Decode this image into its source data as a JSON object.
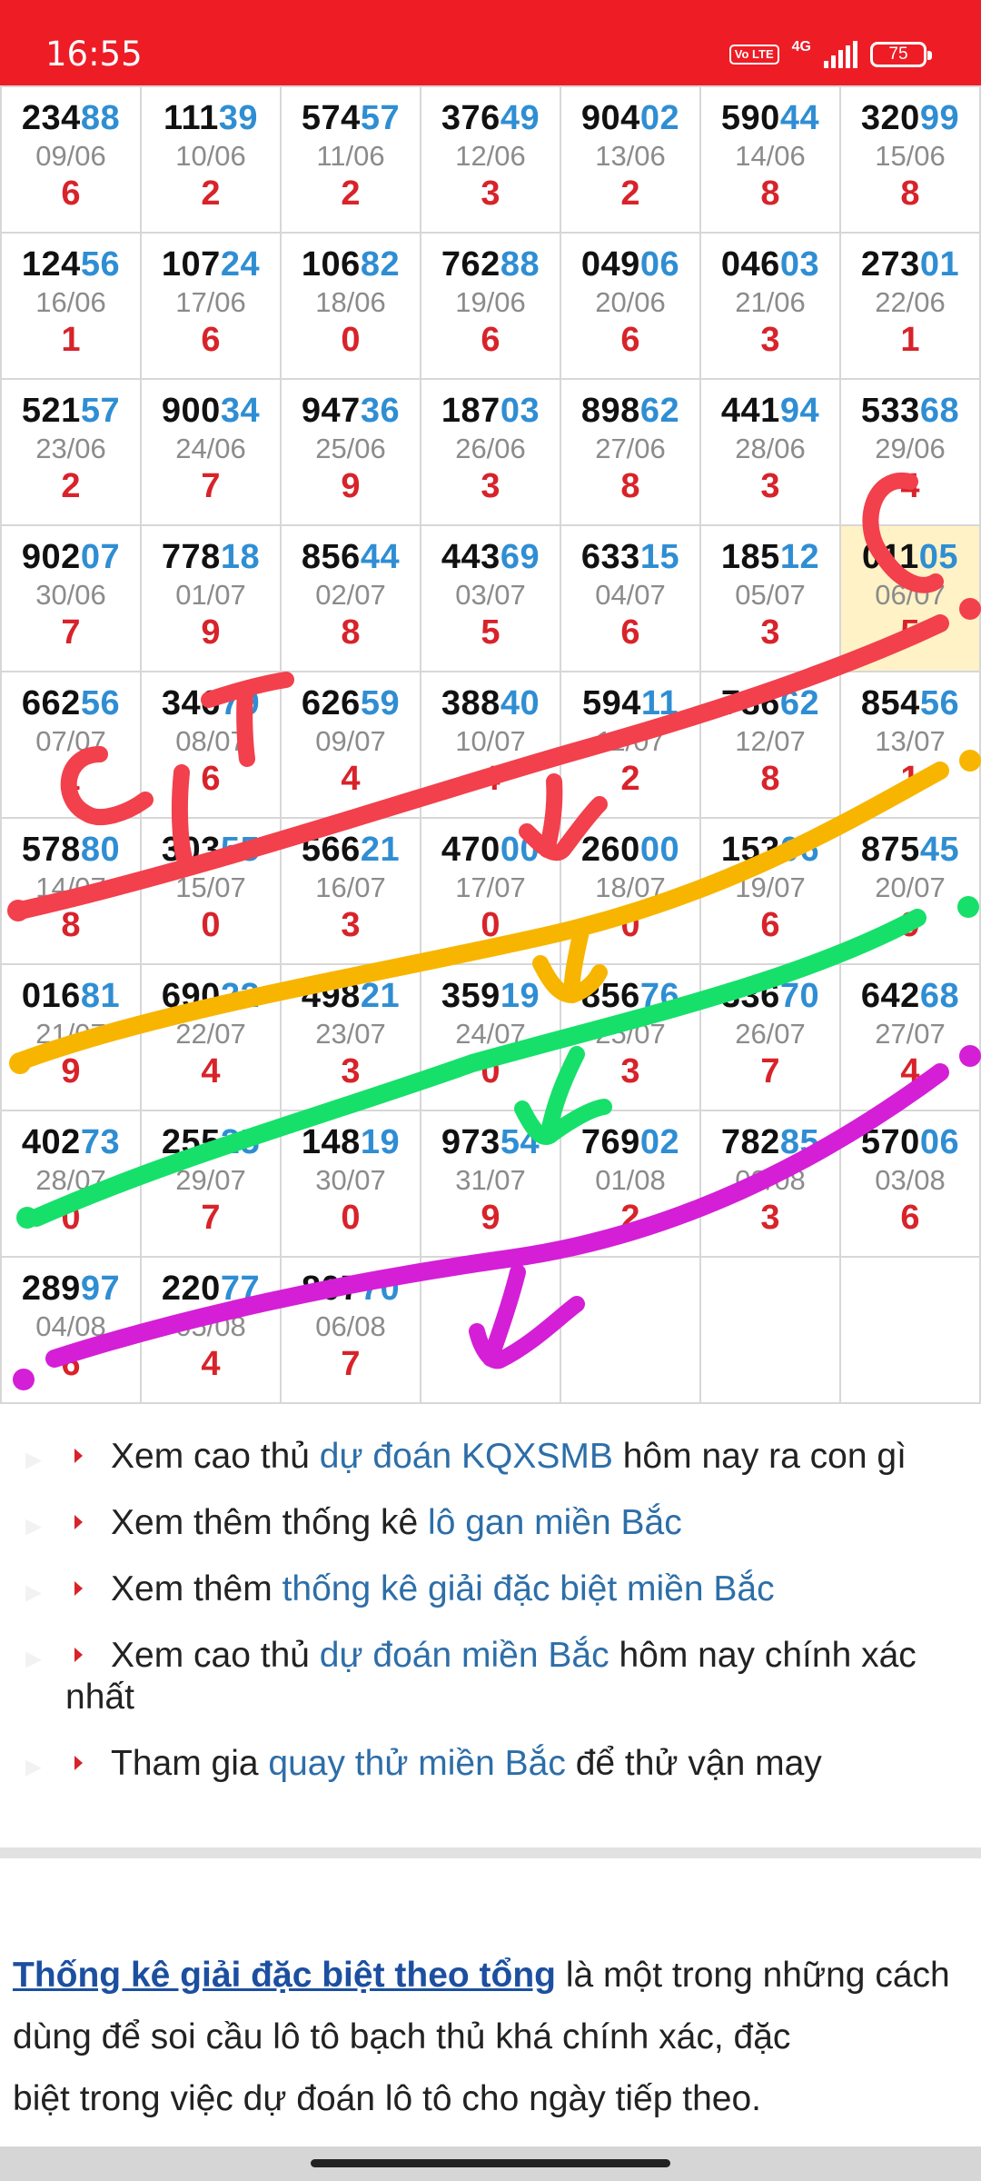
{
  "status_bar": {
    "time": "16:55",
    "volte": "Vo LTE",
    "network": "4G",
    "battery": "75"
  },
  "grid": {
    "rows": [
      [
        {
          "p1": "234",
          "p2": "88",
          "date": "09/06",
          "total": "6"
        },
        {
          "p1": "111",
          "p2": "39",
          "date": "10/06",
          "total": "2"
        },
        {
          "p1": "574",
          "p2": "57",
          "date": "11/06",
          "total": "2"
        },
        {
          "p1": "376",
          "p2": "49",
          "date": "12/06",
          "total": "3"
        },
        {
          "p1": "904",
          "p2": "02",
          "date": "13/06",
          "total": "2"
        },
        {
          "p1": "590",
          "p2": "44",
          "date": "14/06",
          "total": "8"
        },
        {
          "p1": "320",
          "p2": "99",
          "date": "15/06",
          "total": "8"
        }
      ],
      [
        {
          "p1": "124",
          "p2": "56",
          "date": "16/06",
          "total": "1"
        },
        {
          "p1": "107",
          "p2": "24",
          "date": "17/06",
          "total": "6"
        },
        {
          "p1": "106",
          "p2": "82",
          "date": "18/06",
          "total": "0"
        },
        {
          "p1": "762",
          "p2": "88",
          "date": "19/06",
          "total": "6"
        },
        {
          "p1": "049",
          "p2": "06",
          "date": "20/06",
          "total": "6"
        },
        {
          "p1": "046",
          "p2": "03",
          "date": "21/06",
          "total": "3"
        },
        {
          "p1": "273",
          "p2": "01",
          "date": "22/06",
          "total": "1"
        }
      ],
      [
        {
          "p1": "521",
          "p2": "57",
          "date": "23/06",
          "total": "2"
        },
        {
          "p1": "900",
          "p2": "34",
          "date": "24/06",
          "total": "7"
        },
        {
          "p1": "947",
          "p2": "36",
          "date": "25/06",
          "total": "9"
        },
        {
          "p1": "187",
          "p2": "03",
          "date": "26/06",
          "total": "3"
        },
        {
          "p1": "898",
          "p2": "62",
          "date": "27/06",
          "total": "8"
        },
        {
          "p1": "441",
          "p2": "94",
          "date": "28/06",
          "total": "3"
        },
        {
          "p1": "533",
          "p2": "68",
          "date": "29/06",
          "total": "4"
        }
      ],
      [
        {
          "p1": "902",
          "p2": "07",
          "date": "30/06",
          "total": "7"
        },
        {
          "p1": "778",
          "p2": "18",
          "date": "01/07",
          "total": "9"
        },
        {
          "p1": "856",
          "p2": "44",
          "date": "02/07",
          "total": "8"
        },
        {
          "p1": "443",
          "p2": "69",
          "date": "03/07",
          "total": "5"
        },
        {
          "p1": "633",
          "p2": "15",
          "date": "04/07",
          "total": "6"
        },
        {
          "p1": "185",
          "p2": "12",
          "date": "05/07",
          "total": "3"
        },
        {
          "p1": "011",
          "p2": "05",
          "date": "06/07",
          "total": "5",
          "highlight": true
        }
      ],
      [
        {
          "p1": "662",
          "p2": "56",
          "date": "07/07",
          "total": "1"
        },
        {
          "p1": "346",
          "p2": "79",
          "date": "08/07",
          "total": "6"
        },
        {
          "p1": "626",
          "p2": "59",
          "date": "09/07",
          "total": "4"
        },
        {
          "p1": "388",
          "p2": "40",
          "date": "10/07",
          "total": "4"
        },
        {
          "p1": "594",
          "p2": "11",
          "date": "11/07",
          "total": "2"
        },
        {
          "p1": "786",
          "p2": "62",
          "date": "12/07",
          "total": "8"
        },
        {
          "p1": "854",
          "p2": "56",
          "date": "13/07",
          "total": "1"
        }
      ],
      [
        {
          "p1": "578",
          "p2": "80",
          "date": "14/07",
          "total": "8"
        },
        {
          "p1": "303",
          "p2": "55",
          "date": "15/07",
          "total": "0"
        },
        {
          "p1": "566",
          "p2": "21",
          "date": "16/07",
          "total": "3"
        },
        {
          "p1": "470",
          "p2": "00",
          "date": "17/07",
          "total": "0"
        },
        {
          "p1": "260",
          "p2": "00",
          "date": "18/07",
          "total": "0"
        },
        {
          "p1": "153",
          "p2": "06",
          "date": "19/07",
          "total": "6"
        },
        {
          "p1": "875",
          "p2": "45",
          "date": "20/07",
          "total": "9"
        }
      ],
      [
        {
          "p1": "016",
          "p2": "81",
          "date": "21/07",
          "total": "9"
        },
        {
          "p1": "690",
          "p2": "22",
          "date": "22/07",
          "total": "4"
        },
        {
          "p1": "498",
          "p2": "21",
          "date": "23/07",
          "total": "3"
        },
        {
          "p1": "359",
          "p2": "19",
          "date": "24/07",
          "total": "0"
        },
        {
          "p1": "856",
          "p2": "76",
          "date": "25/07",
          "total": "3"
        },
        {
          "p1": "336",
          "p2": "70",
          "date": "26/07",
          "total": "7"
        },
        {
          "p1": "642",
          "p2": "68",
          "date": "27/07",
          "total": "4"
        }
      ],
      [
        {
          "p1": "402",
          "p2": "73",
          "date": "28/07",
          "total": "0"
        },
        {
          "p1": "255",
          "p2": "25",
          "date": "29/07",
          "total": "7"
        },
        {
          "p1": "148",
          "p2": "19",
          "date": "30/07",
          "total": "0"
        },
        {
          "p1": "973",
          "p2": "54",
          "date": "31/07",
          "total": "9"
        },
        {
          "p1": "769",
          "p2": "02",
          "date": "01/08",
          "total": "2"
        },
        {
          "p1": "782",
          "p2": "85",
          "date": "02/08",
          "total": "3"
        },
        {
          "p1": "570",
          "p2": "06",
          "date": "03/08",
          "total": "6"
        }
      ],
      [
        {
          "p1": "289",
          "p2": "97",
          "date": "04/08",
          "total": "6"
        },
        {
          "p1": "220",
          "p2": "77",
          "date": "05/08",
          "total": "4"
        },
        {
          "p1": "807",
          "p2": "70",
          "date": "06/08",
          "total": "7"
        },
        null,
        null,
        null,
        null
      ]
    ]
  },
  "annotation_colors": {
    "red": "#f2404c",
    "orange": "#f7b500",
    "green": "#16e06a",
    "magenta": "#d41fd6"
  },
  "links": [
    {
      "before": "Xem cao thủ ",
      "link": "dự đoán KQXSMB",
      "after": " hôm nay ra con gì"
    },
    {
      "before": "Xem thêm thống kê ",
      "link": "lô gan miền Bắc",
      "after": ""
    },
    {
      "before": "Xem thêm ",
      "link": "thống kê giải đặc biệt miền Bắc",
      "after": ""
    },
    {
      "before": "Xem cao thủ ",
      "link": "dự đoán miền Bắc",
      "after": " hôm nay chính xác",
      "after_line2": "nhất"
    },
    {
      "before": "Tham gia ",
      "link": "quay thử miền Bắc",
      "after": " để thử vận may"
    }
  ],
  "paragraph": {
    "lead": "Thống kê giải đặc biệt theo tổng",
    "line1_rest": " là một trong những cách",
    "line2": "dùng để soi cầu lô tô bạch thủ khá chính xác, đặc",
    "line3": "biệt trong việc dự đoán lô tô cho ngày tiếp theo."
  }
}
